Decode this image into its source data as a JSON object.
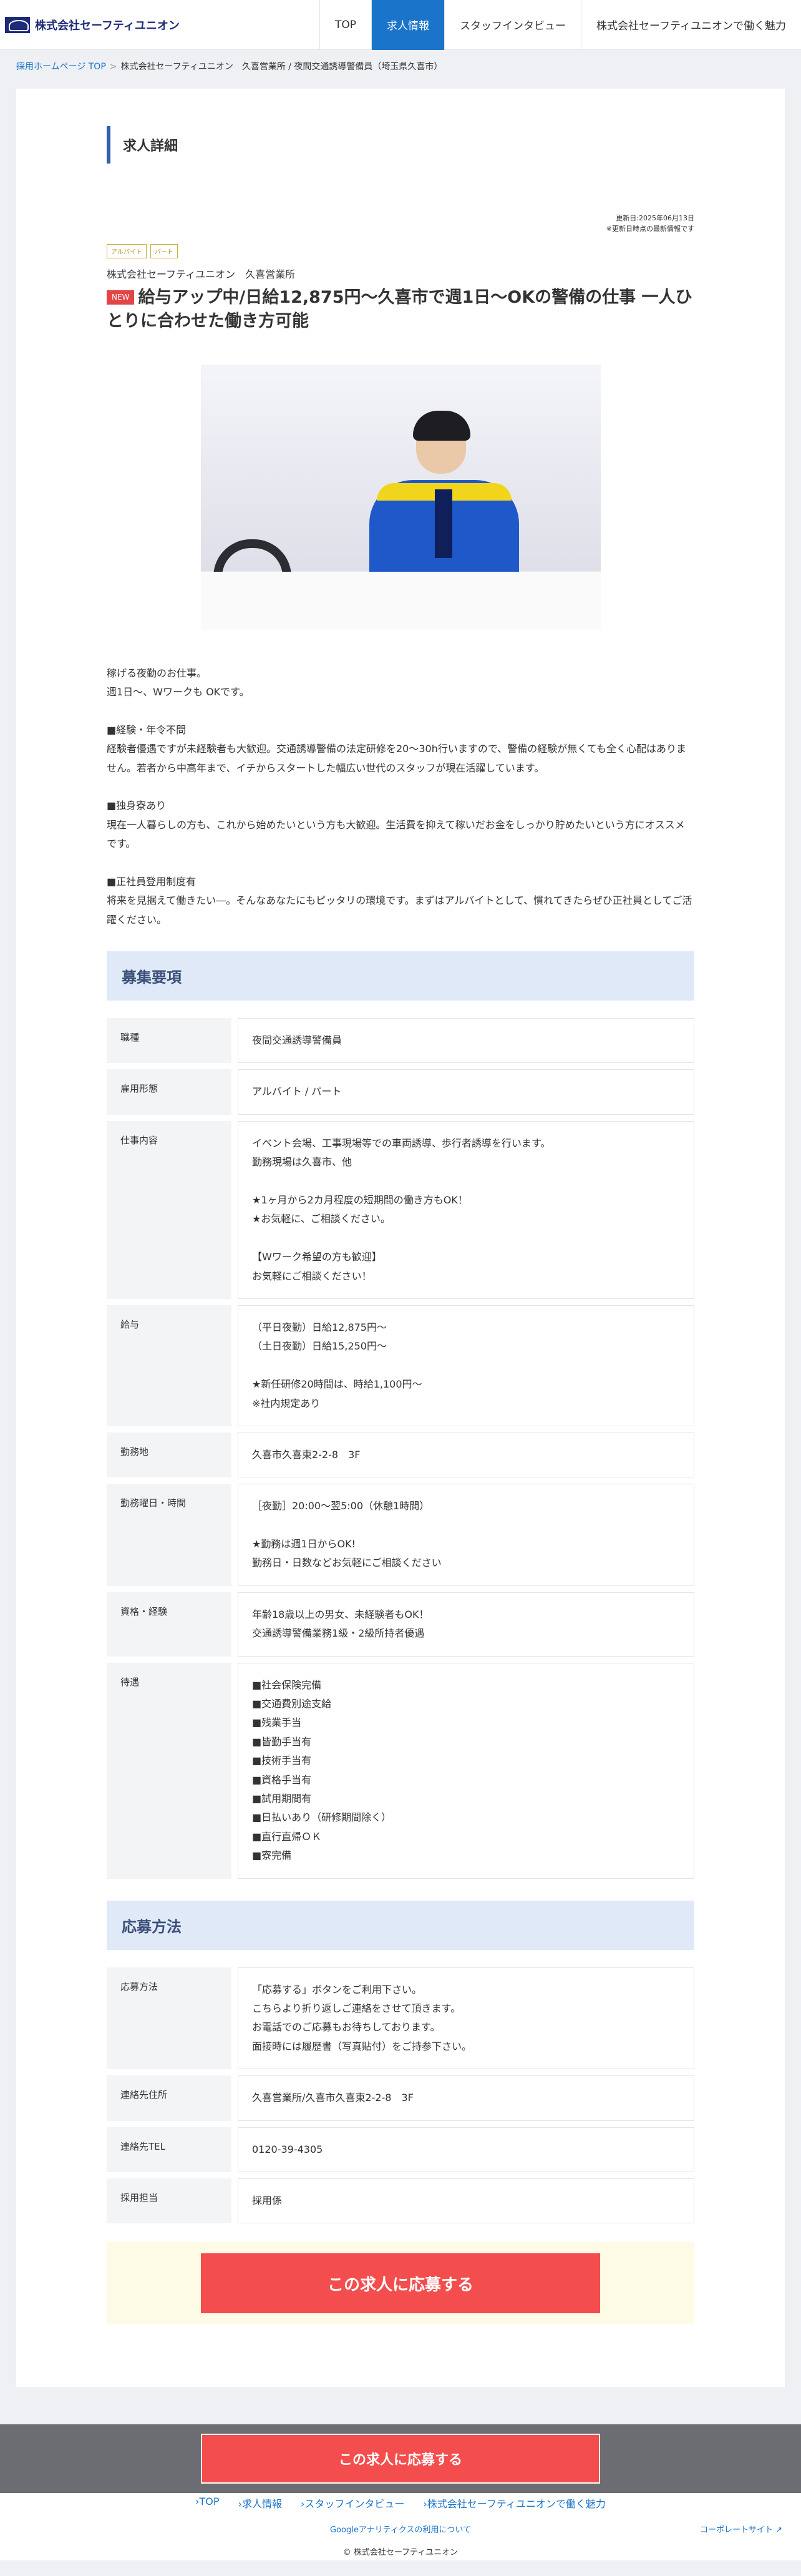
{
  "header": {
    "logo_text": "株式会社セーフティユニオン",
    "nav": [
      "TOP",
      "求人情報",
      "スタッフインタビュー",
      "株式会社セーフティユニオンで働く魅力"
    ],
    "active_nav": "求人情報"
  },
  "breadcrumb": {
    "home": "採用ホームページ TOP",
    "current": "株式会社セーフティユニオン　久喜営業所 / 夜間交通誘導警備員（埼玉県久喜市）"
  },
  "detail": {
    "section_title": "求人詳細",
    "updated_date": "更新日:2025年06月13日",
    "updated_note": "※更新日時点の最新情報です",
    "tags": [
      "アルバイト",
      "パート"
    ],
    "company": "株式会社セーフティユニオン　久喜営業所",
    "new_badge": "NEW",
    "title": "給与アップ中/日給12,875円〜久喜市で週1日〜OKの警備の仕事 一人ひとりに合わせた働き方可能",
    "description": "稼げる夜勤のお仕事。\n週1日〜、Wワークも OKです。\n\n■経験・年令不問\n経験者優遇ですが未経験者も大歓迎。交通誘導警備の法定研修を20〜30h行いますので、警備の経験が無くても全く心配はありません。若者から中高年まで、イチからスタートした幅広い世代のスタッフが現在活躍しています。\n\n■独身寮あり\n現在一人暮らしの方も、これから始めたいという方も大歓迎。生活費を抑えて稼いだお金をしっかり貯めたいという方にオススメです。\n\n■正社員登用制度有\n将来を見据えて働きたい―。そんなあなたにもピッタリの環境です。まずはアルバイトとして、慣れてきたらぜひ正社員としてご活躍ください。"
  },
  "requirements": {
    "title": "募集要項",
    "rows": [
      {
        "label": "職種",
        "value": "夜間交通誘導警備員"
      },
      {
        "label": "雇用形態",
        "value": "アルバイト / パート"
      },
      {
        "label": "仕事内容",
        "value": "イベント会場、工事現場等での車両誘導、歩行者誘導を行います。\n勤務現場は久喜市、他\n\n★1ヶ月から2カ月程度の短期間の働き方もOK！\n★お気軽に、ご相談ください。\n\n【Wワーク希望の方も歓迎】\nお気軽にご相談ください！"
      },
      {
        "label": "給与",
        "value": "（平日夜勤）日給12,875円〜\n（土日夜勤）日給15,250円〜\n\n★新任研修20時間は、時給1,100円〜\n※社内規定あり"
      },
      {
        "label": "勤務地",
        "value": "久喜市久喜東2-2-8　3F"
      },
      {
        "label": "勤務曜日・時間",
        "value": "［夜勤］20:00〜翌5:00（休憩1時間）\n\n★勤務は週1日からOK!\n勤務日・日数などお気軽にご相談ください"
      },
      {
        "label": "資格・経験",
        "value": "年齢18歳以上の男女、未経験者もOK！\n交通誘導警備業務1級・2級所持者優遇"
      },
      {
        "label": "待遇",
        "value": "■社会保険完備\n■交通費別途支給\n■残業手当\n■皆勤手当有\n■技術手当有\n■資格手当有\n■試用期間有\n■日払いあり（研修期間除く）\n■直行直帰ＯＫ\n■寮完備"
      }
    ]
  },
  "application": {
    "title": "応募方法",
    "rows": [
      {
        "label": "応募方法",
        "value": "「応募する」ボタンをご利用下さい。\nこちらより折り返しご連絡をさせて頂きます。\nお電話でのご応募もお待ちしております。\n面接時には履歴書（写真貼付）をご持参下さい。"
      },
      {
        "label": "連絡先住所",
        "value": "久喜営業所/久喜市久喜東2-2-8　3F"
      },
      {
        "label": "連絡先TEL",
        "value": "0120-39-4305"
      },
      {
        "label": "採用担当",
        "value": "採用係"
      }
    ],
    "apply_button": "この求人に応募する"
  },
  "footer": {
    "apply_button": "この求人に応募する",
    "links": [
      "TOP",
      "求人情報",
      "スタッフインタビュー",
      "株式会社セーフティユニオンで働く魅力"
    ],
    "ga_link": "Googleアナリティクスの利用について",
    "corporate_link": "コーポレートサイト",
    "copyright": "© 株式会社セーフティユニオン"
  }
}
